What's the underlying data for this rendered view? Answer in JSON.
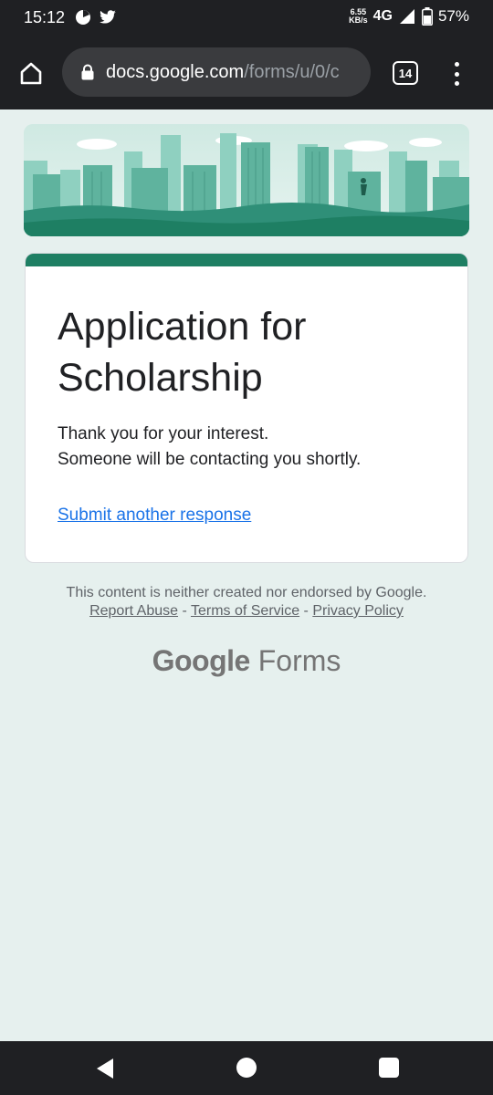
{
  "status_bar": {
    "time": "15:12",
    "net_speed_value": "6.55",
    "net_speed_unit": "KB/s",
    "network_type": "4G",
    "battery_percent": "57%",
    "icons": [
      "pie-app-icon",
      "twitter-icon",
      "signal-icon",
      "battery-icon"
    ]
  },
  "browser": {
    "url_host": "docs.google.com",
    "url_path": "/forms/u/0/c",
    "tab_count": "14"
  },
  "form": {
    "title": "Application for Scholarship",
    "message_line1": "Thank you for your interest.",
    "message_line2": "Someone will be contacting you shortly.",
    "submit_another_link": "Submit another response",
    "accent_color": "#1e7f63",
    "link_color": "#1a73e8"
  },
  "footer": {
    "disclaimer": "This content is neither created nor endorsed by Google.",
    "report_abuse": "Report Abuse",
    "separator1": " - ",
    "terms": "Terms of Service",
    "separator2": " - ",
    "privacy": "Privacy Policy",
    "brand_google": "Google",
    "brand_forms": " Forms"
  }
}
